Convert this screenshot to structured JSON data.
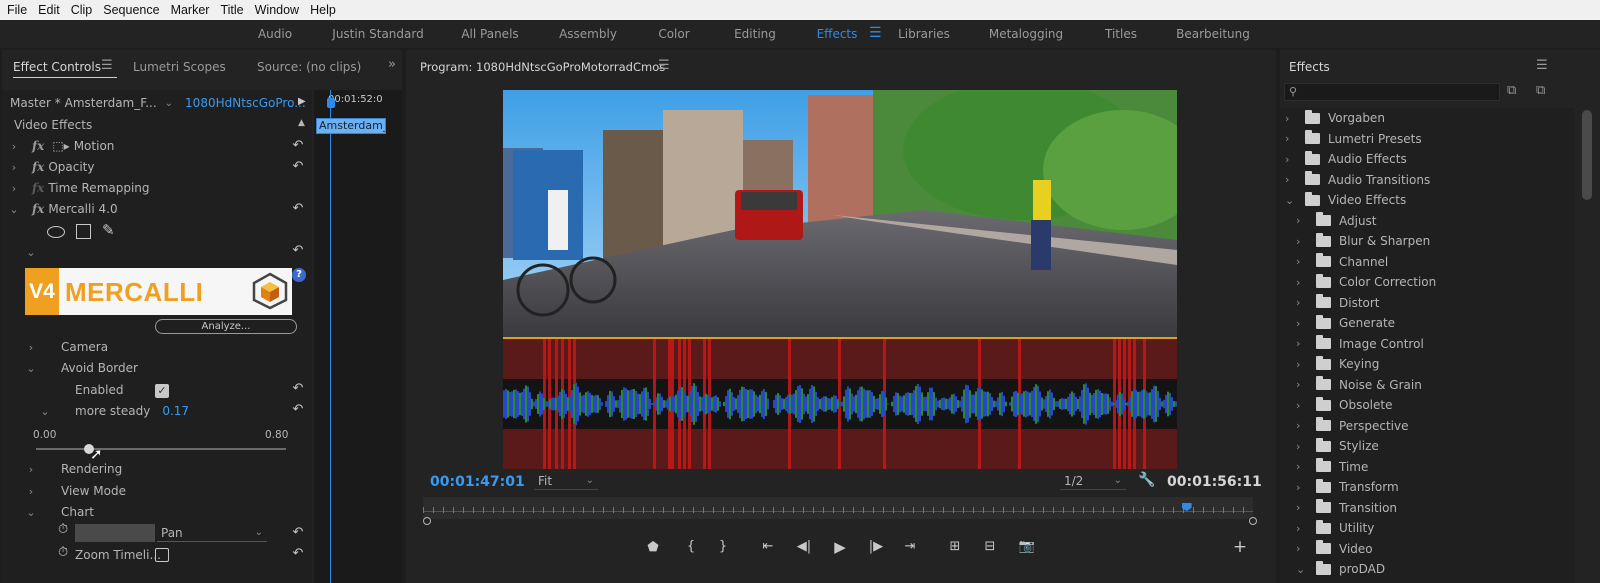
{
  "menu": [
    "File",
    "Edit",
    "Clip",
    "Sequence",
    "Marker",
    "Title",
    "Window",
    "Help"
  ],
  "workspaces": [
    {
      "label": "Audio",
      "active": false
    },
    {
      "label": "Justin Standard",
      "active": false
    },
    {
      "label": "All Panels",
      "active": false
    },
    {
      "label": "Assembly",
      "active": false
    },
    {
      "label": "Color",
      "active": false
    },
    {
      "label": "Editing",
      "active": false
    },
    {
      "label": "Effects",
      "active": true
    },
    {
      "label": "Libraries",
      "active": false
    },
    {
      "label": "Metalogging",
      "active": false
    },
    {
      "label": "Titles",
      "active": false
    },
    {
      "label": "Bearbeitung",
      "active": false
    }
  ],
  "effect_controls": {
    "tab_active": "Effect Controls",
    "tab_lumetri": "Lumetri Scopes",
    "tab_source": "Source: (no clips)",
    "master_clip": "Master * Amsterdam_F...",
    "sequence_clip": "1080HdNtscGoPro...",
    "mini_timecode": "00:01:52:0",
    "clip_label": "Amsterdam_",
    "section": "Video Effects",
    "effects": {
      "motion": "Motion",
      "opacity": "Opacity",
      "time_remap": "Time Remapping",
      "mercalli": "Mercalli 4.0"
    },
    "logo_v4": "V4",
    "logo_name": "MERCALLI",
    "analyze_label": "Analyze...",
    "camera": "Camera",
    "avoid_border": "Avoid Border",
    "enabled_label": "Enabled",
    "more_steady_label": "more steady",
    "more_steady_value": "0.17",
    "slider_min": "0.00",
    "slider_max": "0.80",
    "slider_fraction": 0.2125,
    "rendering": "Rendering",
    "view_mode": "View Mode",
    "chart": "Chart",
    "chart_mode": "Pan",
    "zoom_timeline": "Zoom Timeli..."
  },
  "program": {
    "title": "Program: 1080HdNtscGoProMotorradCmos",
    "current_tc": "00:01:47:01",
    "fit": "Fit",
    "resolution": "1/2",
    "duration_tc": "00:01:56:11",
    "playhead_fraction": 0.92
  },
  "effects_panel": {
    "title": "Effects",
    "search_placeholder": "",
    "items": [
      {
        "label": "Vorgaben",
        "level": 0,
        "icon": "preset-folder-icon"
      },
      {
        "label": "Lumetri Presets",
        "level": 0,
        "icon": "preset-folder-icon"
      },
      {
        "label": "Audio Effects",
        "level": 0,
        "icon": "folder-icon"
      },
      {
        "label": "Audio Transitions",
        "level": 0,
        "icon": "folder-icon"
      },
      {
        "label": "Video Effects",
        "level": 0,
        "icon": "folder-icon",
        "open": true
      },
      {
        "label": "Adjust",
        "level": 1,
        "icon": "folder-icon"
      },
      {
        "label": "Blur & Sharpen",
        "level": 1,
        "icon": "folder-icon"
      },
      {
        "label": "Channel",
        "level": 1,
        "icon": "folder-icon"
      },
      {
        "label": "Color Correction",
        "level": 1,
        "icon": "folder-icon"
      },
      {
        "label": "Distort",
        "level": 1,
        "icon": "folder-icon"
      },
      {
        "label": "Generate",
        "level": 1,
        "icon": "folder-icon"
      },
      {
        "label": "Image Control",
        "level": 1,
        "icon": "folder-icon"
      },
      {
        "label": "Keying",
        "level": 1,
        "icon": "folder-icon"
      },
      {
        "label": "Noise & Grain",
        "level": 1,
        "icon": "folder-icon"
      },
      {
        "label": "Obsolete",
        "level": 1,
        "icon": "folder-icon"
      },
      {
        "label": "Perspective",
        "level": 1,
        "icon": "folder-icon"
      },
      {
        "label": "Stylize",
        "level": 1,
        "icon": "folder-icon"
      },
      {
        "label": "Time",
        "level": 1,
        "icon": "folder-icon"
      },
      {
        "label": "Transform",
        "level": 1,
        "icon": "folder-icon"
      },
      {
        "label": "Transition",
        "level": 1,
        "icon": "folder-icon"
      },
      {
        "label": "Utility",
        "level": 1,
        "icon": "folder-icon"
      },
      {
        "label": "Video",
        "level": 1,
        "icon": "folder-icon"
      },
      {
        "label": "proDAD",
        "level": 1,
        "icon": "folder-icon",
        "open": true
      }
    ]
  },
  "colors": {
    "accent": "#2d8ceb",
    "logo_orange": "#f0a020",
    "graph_red": "#c01818",
    "graph_blue": "#2848c8",
    "graph_green": "#2a8a2a"
  }
}
